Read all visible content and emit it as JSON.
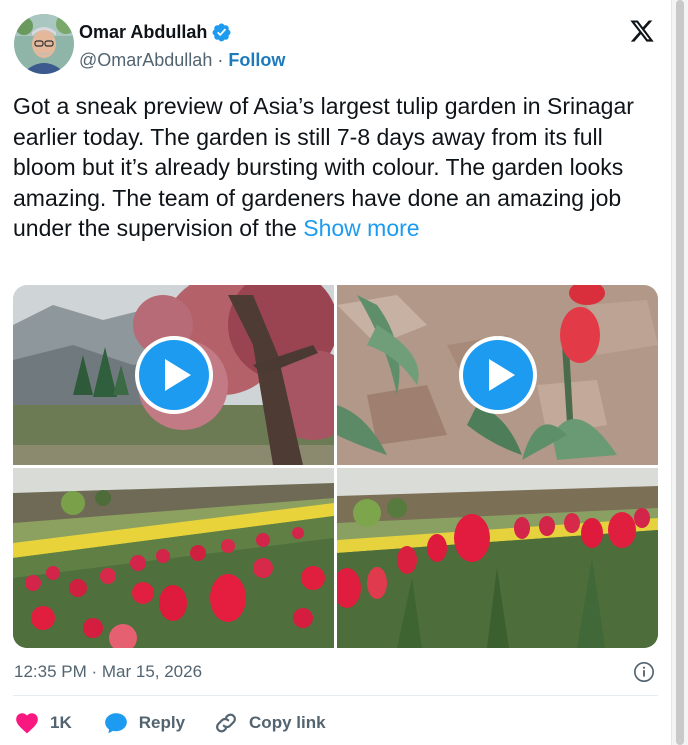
{
  "user": {
    "name": "Omar Abdullah",
    "handle": "@OmarAbdullah",
    "separator": "·",
    "follow_label": "Follow",
    "verified_icon": "verified-badge-icon"
  },
  "tweet": {
    "text": "Got a sneak preview of Asia’s largest tulip garden in Srinagar earlier today. The garden is still 7-8 days away from its full bloom but it’s already bursting with colour. The garden looks amazing. The team of gardeners have done an amazing job under the supervision of the ",
    "show_more": "Show more",
    "timestamp": "12:35 PM · Mar 15, 2026"
  },
  "media": {
    "tiles": [
      {
        "kind": "video",
        "scene": "blossom tree and mountains",
        "icon": "play-icon"
      },
      {
        "kind": "video",
        "scene": "tulip sprouting from dry soil",
        "icon": "play-icon"
      },
      {
        "kind": "image",
        "scene": "red and yellow tulip rows"
      },
      {
        "kind": "image",
        "scene": "red tulips close-up"
      }
    ]
  },
  "actions": {
    "like_count": "1K",
    "reply_label": "Reply",
    "copy_link_label": "Copy link"
  },
  "colors": {
    "accent": "#1d9bf0",
    "follow": "#1d7bbd",
    "like": "#f91880",
    "text": "#0f1419",
    "muted": "#536471"
  }
}
